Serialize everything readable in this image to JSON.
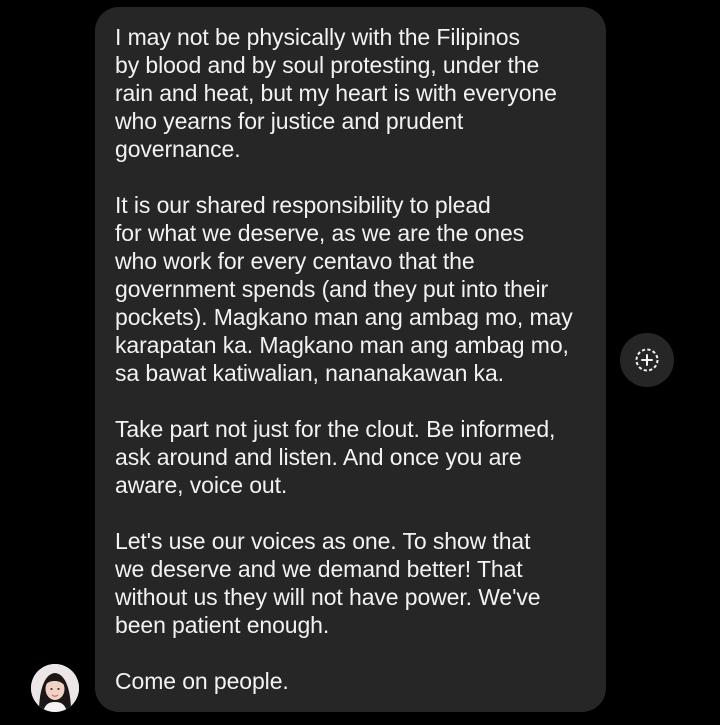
{
  "message": {
    "paragraphs": [
      {
        "lines": [
          "I may not be physically with the Filipinos",
          "by blood and by soul protesting, under the",
          "rain and heat, but my heart is with everyone",
          "who yearns for justice and prudent",
          "governance."
        ]
      },
      {
        "lines": [
          "It is our shared responsibility to plead",
          "for what we deserve, as we are the ones",
          "who work for every centavo that the",
          "government spends (and they put into their",
          "pockets). Magkano man ang ambag mo, may",
          "karapatan ka. Magkano man ang ambag mo,",
          "sa bawat katiwalian, nananakawan ka."
        ]
      },
      {
        "lines": [
          "Take part not just for the clout. Be informed,",
          "ask around and listen. And once you are",
          "aware, voice out."
        ]
      },
      {
        "lines": [
          "Let's use our voices as one. To show that",
          "we deserve and we demand better! That",
          "without us they will not have power. We've",
          "been patient enough."
        ]
      },
      {
        "lines": [
          "Come on people."
        ]
      }
    ]
  },
  "actions": {
    "react_icon": "add-reaction-icon"
  },
  "sender": {
    "avatar_icon": "profile-photo"
  },
  "colors": {
    "background": "#000000",
    "bubble": "#262626",
    "text": "#f2f2f2"
  }
}
